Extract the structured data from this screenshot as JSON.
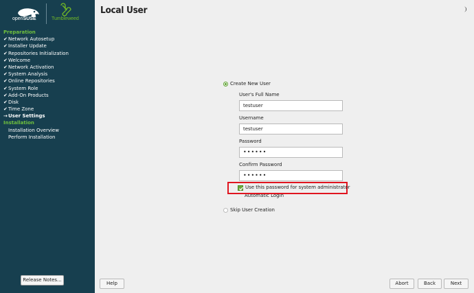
{
  "sidebar": {
    "brand": {
      "open": "open",
      "suse": "SUSE",
      "distro": "Tumbleweed"
    },
    "sections": [
      {
        "title": "Preparation",
        "steps": [
          {
            "label": "Network Autosetup",
            "mark": "✔"
          },
          {
            "label": "Installer Update",
            "mark": "✔"
          },
          {
            "label": "Repositories Initialization",
            "mark": "✔"
          },
          {
            "label": "Welcome",
            "mark": "✔"
          },
          {
            "label": "Network Activation",
            "mark": "✔"
          },
          {
            "label": "System Analysis",
            "mark": "✔"
          },
          {
            "label": "Online Repositories",
            "mark": "✔"
          },
          {
            "label": "System Role",
            "mark": "✔"
          },
          {
            "label": "Add-On Products",
            "mark": "✔"
          },
          {
            "label": "Disk",
            "mark": "✔"
          },
          {
            "label": "Time Zone",
            "mark": "✔"
          },
          {
            "label": "User Settings",
            "mark": "→"
          }
        ]
      },
      {
        "title": "Installation",
        "steps": [
          {
            "label": "Installation Overview",
            "mark": ""
          },
          {
            "label": "Perform Installation",
            "mark": ""
          }
        ]
      }
    ],
    "release_notes_label": "Release Notes..."
  },
  "main": {
    "title": "Local User",
    "theme_icon": "moon-icon",
    "create_user_label": "Create New User",
    "full_name_label": "User's Full Name",
    "full_name_value": "testuser",
    "username_label": "Username",
    "username_value": "testuser",
    "password_label": "Password",
    "password_value": "••••••",
    "confirm_password_label": "Confirm Password",
    "confirm_password_value": "••••••",
    "admin_password_label": "Use this password for system administrator",
    "auto_login_label": "Automatic Login",
    "skip_user_label": "Skip User Creation"
  },
  "footer": {
    "help_label": "Help",
    "abort_label": "Abort",
    "back_label": "Back",
    "next_label": "Next"
  },
  "colors": {
    "sidebar_bg": "#173f4f",
    "accent_green": "#73ba25",
    "highlight_red": "#e0141e"
  }
}
